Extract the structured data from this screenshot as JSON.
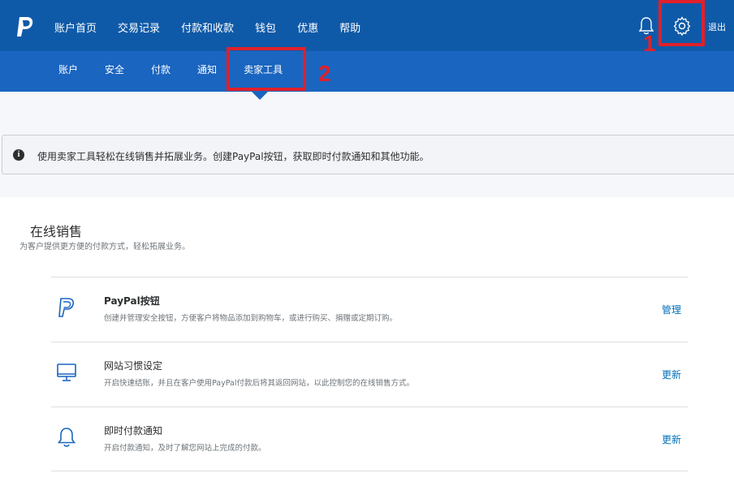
{
  "topnav": {
    "logo_icon": "paypal-logo-icon",
    "items": [
      "账户首页",
      "交易记录",
      "付款和收款",
      "钱包",
      "优惠",
      "帮助"
    ],
    "bell_icon": "bell-icon",
    "gear_icon": "gear-icon",
    "logout_label": "退出"
  },
  "subnav": {
    "items": [
      "账户",
      "安全",
      "付款",
      "通知",
      "卖家工具"
    ],
    "active_index": 4
  },
  "annotations": {
    "marker_1": "1",
    "marker_2": "2",
    "color": "#e0202a"
  },
  "info_bar": {
    "icon": "info-icon",
    "icon_glyph": "i",
    "text": "使用卖家工具轻松在线销售并拓展业务。创建PayPal按钮，获取即时付款通知和其他功能。"
  },
  "section": {
    "title": "在线销售",
    "subtitle": "为客户提供更方便的付款方式，轻松拓展业务。",
    "rows": [
      {
        "icon": "paypal-p-icon",
        "title": "PayPal按钮",
        "description": "创建并管理安全按钮，方便客户将物品添加到购物车，或进行购买、捐赠或定期订购。",
        "action": "管理"
      },
      {
        "icon": "monitor-icon",
        "title": "网站习惯设定",
        "description": "开启快速结账，并且在客户使用PayPal付款后将其返回网站，以此控制您的在线销售方式。",
        "action": "更新"
      },
      {
        "icon": "bell-icon",
        "title": "即时付款通知",
        "description": "开启付款通知，及时了解您网站上完成的付款。",
        "action": "更新"
      }
    ]
  },
  "colors": {
    "topbar": "#0f5aa8",
    "subbar": "#1a65c0",
    "link": "#0070ba"
  }
}
